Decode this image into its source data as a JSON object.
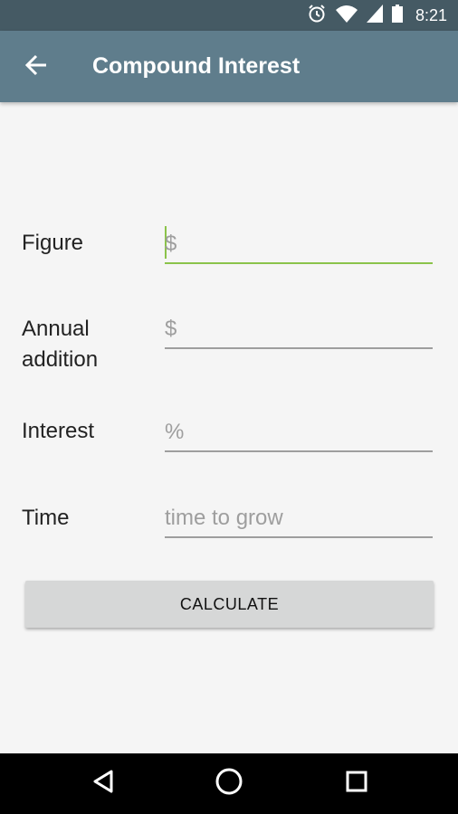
{
  "status_bar": {
    "time": "8:21",
    "icons": [
      "alarm-icon",
      "wifi-icon",
      "signal-icon",
      "battery-icon"
    ]
  },
  "app_bar": {
    "title": "Compound Interest",
    "back_icon": "arrow-back-icon"
  },
  "form": {
    "fields": [
      {
        "label": "Figure",
        "placeholder": "$",
        "value": ""
      },
      {
        "label": "Annual addition",
        "placeholder": "$",
        "value": ""
      },
      {
        "label": "Interest",
        "placeholder": "%",
        "value": ""
      },
      {
        "label": "Time",
        "placeholder": "time to grow",
        "value": ""
      }
    ],
    "calculate_label": "CALCULATE"
  },
  "nav_bar": {
    "icons": [
      "back-triangle-icon",
      "home-circle-icon",
      "recents-square-icon"
    ]
  },
  "colors": {
    "status_bar": "#455a64",
    "app_bar": "#5f7d8c",
    "accent": "#8bc34a",
    "button": "#d6d7d7"
  }
}
